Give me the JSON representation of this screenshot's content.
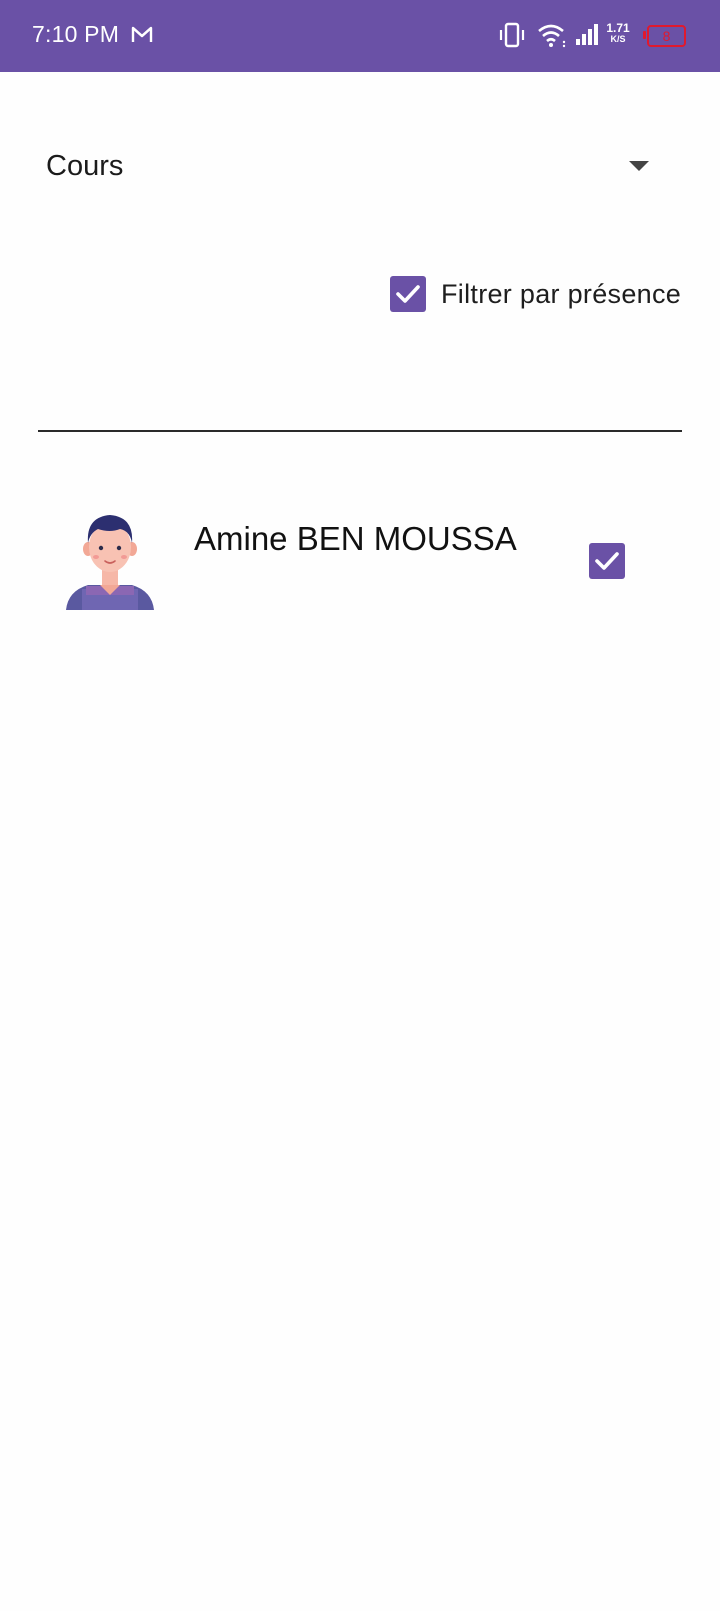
{
  "status_bar": {
    "time": "7:10 PM",
    "notification_icons": [
      "gmail-icon"
    ],
    "system_icons": [
      "vibrate-icon",
      "wifi-icon",
      "signal-icon"
    ],
    "net_speed_value": "1.71",
    "net_speed_unit": "K/S",
    "battery_level": "8",
    "battery_color": "#e0192e"
  },
  "colors": {
    "accent": "#6a51a6",
    "background": "#fefefe"
  },
  "course_select": {
    "selected_label": "Cours",
    "icon": "dropdown-arrow-icon"
  },
  "filter": {
    "label": "Filtrer par présence",
    "checked": true
  },
  "students": [
    {
      "name": "Amine BEN MOUSSA",
      "avatar": "avatar-icon",
      "present": true
    }
  ]
}
